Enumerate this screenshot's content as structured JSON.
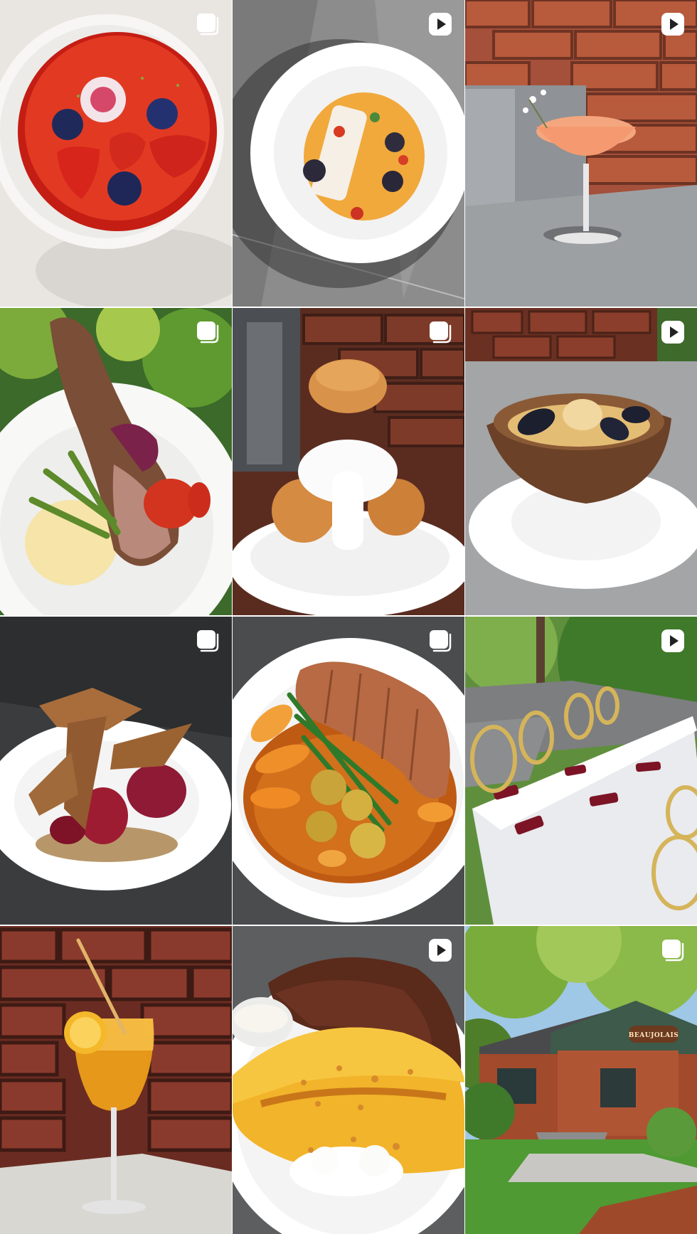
{
  "grid": {
    "tiles": [
      {
        "alt": "",
        "type": "carousel",
        "icon": "carousel-icon"
      },
      {
        "alt": "",
        "type": "reel",
        "icon": "reel-icon"
      },
      {
        "alt": "",
        "type": "reel",
        "icon": "reel-icon"
      },
      {
        "alt": "",
        "type": "carousel",
        "icon": "carousel-icon"
      },
      {
        "alt": "",
        "type": "carousel",
        "icon": "carousel-icon"
      },
      {
        "alt": "",
        "type": "reel",
        "icon": "reel-icon"
      },
      {
        "alt": "",
        "type": "carousel",
        "icon": "carousel-icon"
      },
      {
        "alt": "",
        "type": "carousel",
        "icon": "carousel-icon"
      },
      {
        "alt": "",
        "type": "reel",
        "icon": "reel-icon"
      },
      {
        "alt": "",
        "type": "none",
        "icon": ""
      },
      {
        "alt": "",
        "type": "reel",
        "icon": "reel-icon"
      },
      {
        "alt": "",
        "type": "carousel",
        "icon": "carousel-icon"
      }
    ]
  },
  "signage": {
    "restaurant_sign": "BEAUJOLAIS"
  },
  "colors": {
    "badge": "#ffffff",
    "background": "#ffffff"
  }
}
